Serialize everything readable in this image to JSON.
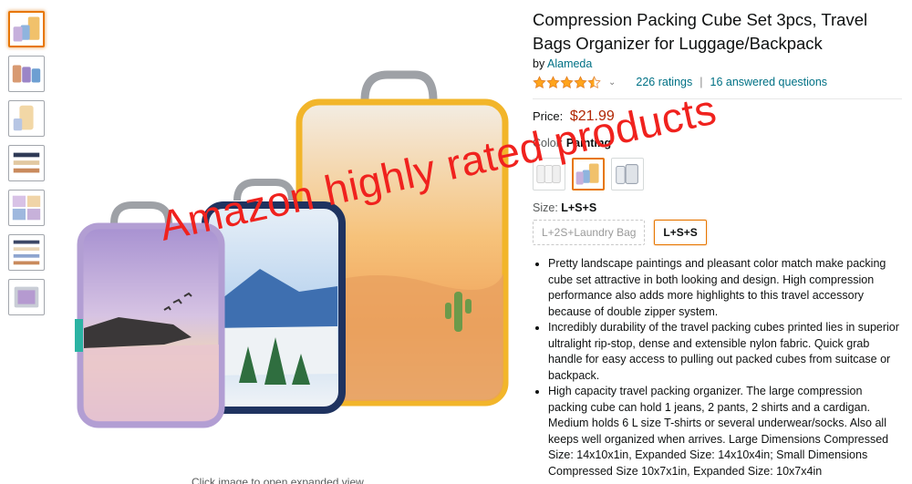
{
  "gallery": {
    "thumbnails": [
      "thumb-1",
      "thumb-2",
      "thumb-3",
      "thumb-4",
      "thumb-5",
      "thumb-6",
      "thumb-7"
    ],
    "click_hint": "Click image to open expanded view"
  },
  "product": {
    "title": "Compression Packing Cube Set 3pcs, Travel Bags Organizer for Luggage/Backpack",
    "by_label": "by",
    "brand": "Alameda",
    "rating": 4.5,
    "ratings_count": "226 ratings",
    "separator": "|",
    "answered": "16 answered questions",
    "price_label": "Price:",
    "price": "$21.99",
    "color_label": "Color:",
    "color_value": "Painting",
    "size_label": "Size:",
    "size_value": "L+S+S",
    "size_options": [
      "L+2S+Laundry Bag",
      "L+S+S"
    ],
    "bullets": [
      "Pretty landscape paintings and pleasant color match make packing cube set attractive in both looking and design. High compression performance also adds more highlights to this travel accessory because of double zipper system.",
      "Incredibly durability of the travel packing cubes printed lies in superior ultralight rip-stop, dense and extensible nylon fabric. Quick grab handle for easy access to pulling out packed cubes from suitcase or backpack.",
      "High capacity travel packing organizer. The large compression packing cube can hold 1 jeans, 2 pants, 2 shirts and a cardigan. Medium holds 6 L size T-shirts or several underwear/socks. Also all keeps well organized when arrives. Large Dimensions Compressed Size: 14x10x1in, Expanded Size: 14x10x4in; Small Dimensions Compressed Size 10x7x1in, Expanded Size: 10x7x4in"
    ]
  },
  "overlay_text": "Amazon highly rated products",
  "colors": {
    "link": "#007185",
    "price": "#b12704",
    "star": "#ffa41c",
    "overlay": "#f0221e",
    "selected_border": "#e77600"
  }
}
